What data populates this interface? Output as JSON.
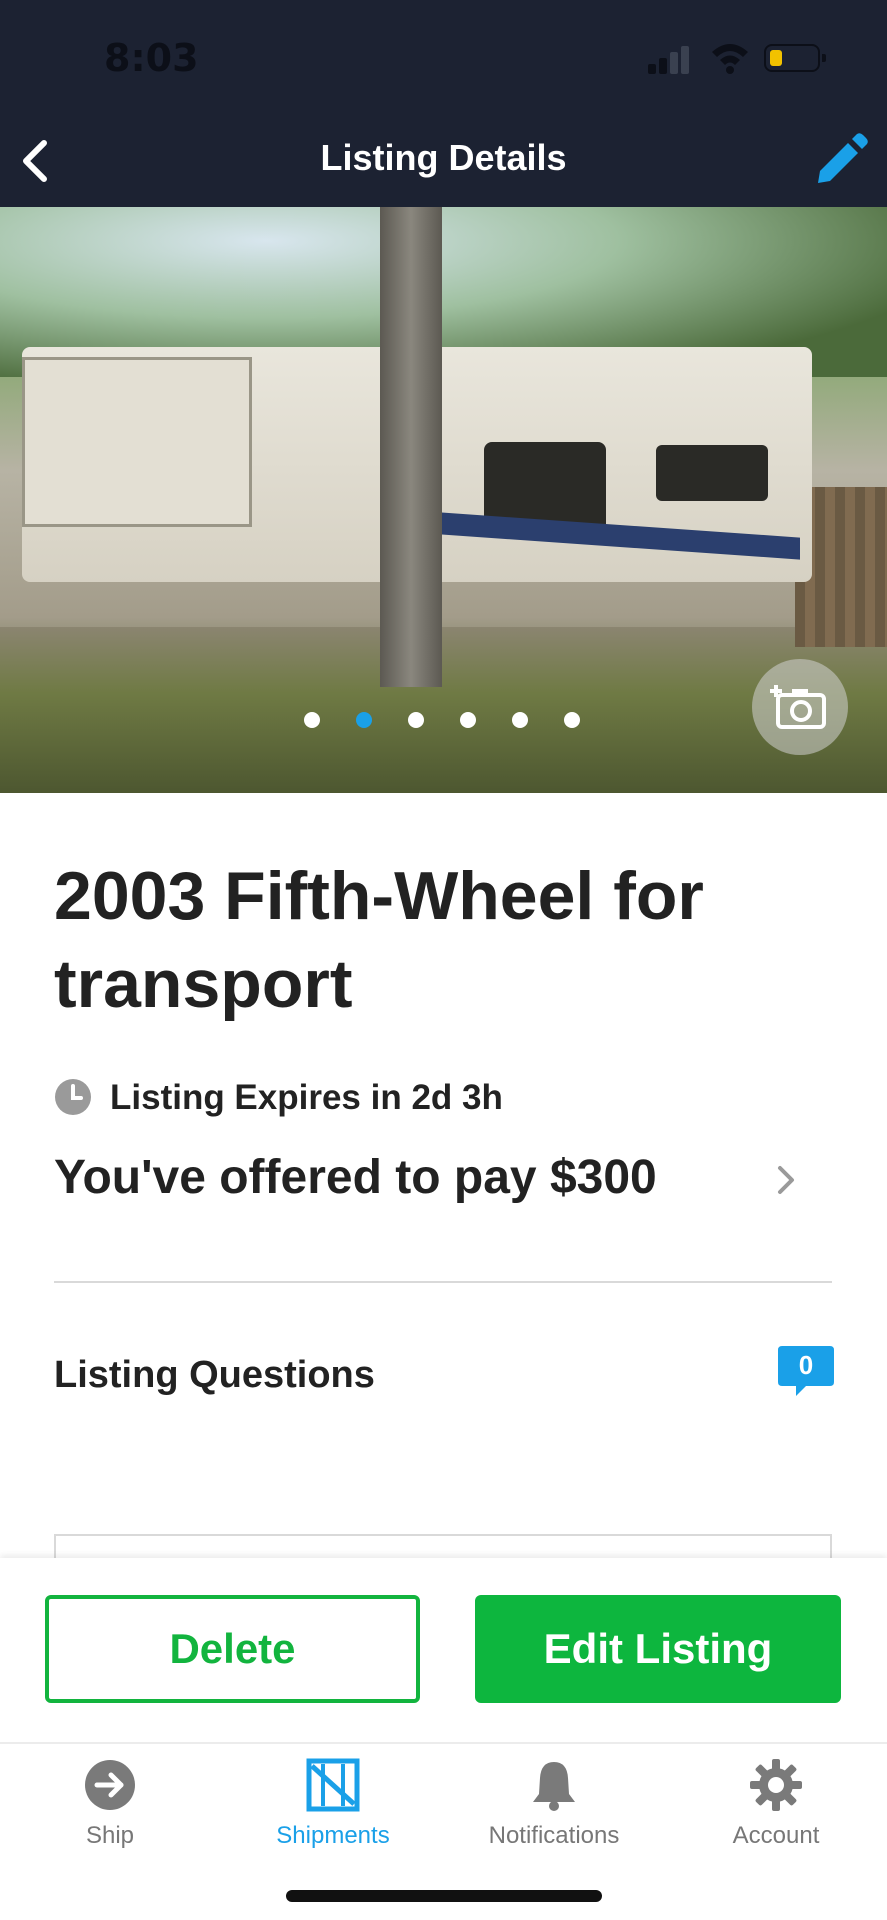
{
  "status_bar": {
    "time": "8:03",
    "icons": [
      "cellular-signal-icon",
      "wifi-icon",
      "battery-low-icon"
    ],
    "battery_color": "#f2c200"
  },
  "nav": {
    "title": "Listing Details",
    "back_icon": "chevron-left-icon",
    "edit_icon": "pencil-icon",
    "background": "#1c2232",
    "accent": "#1aa0e8"
  },
  "gallery": {
    "photo_count": 6,
    "active_index": 1,
    "add_photo_icon": "add-photo-camera-icon"
  },
  "listing": {
    "title": "2003 Fifth-Wheel for transport",
    "expires_text": "Listing Expires in 2d 3h",
    "offer_text": "You've offered to pay $300",
    "questions_label": "Listing Questions",
    "questions_count": "0"
  },
  "actions": {
    "delete_label": "Delete",
    "edit_label": "Edit Listing",
    "green": "#0db63e"
  },
  "tabs": [
    {
      "label": "Ship",
      "icon": "arrow-circle-icon",
      "active": false
    },
    {
      "label": "Shipments",
      "icon": "shipments-icon",
      "active": true
    },
    {
      "label": "Notifications",
      "icon": "bell-icon",
      "active": false
    },
    {
      "label": "Account",
      "icon": "gear-icon",
      "active": false
    }
  ]
}
